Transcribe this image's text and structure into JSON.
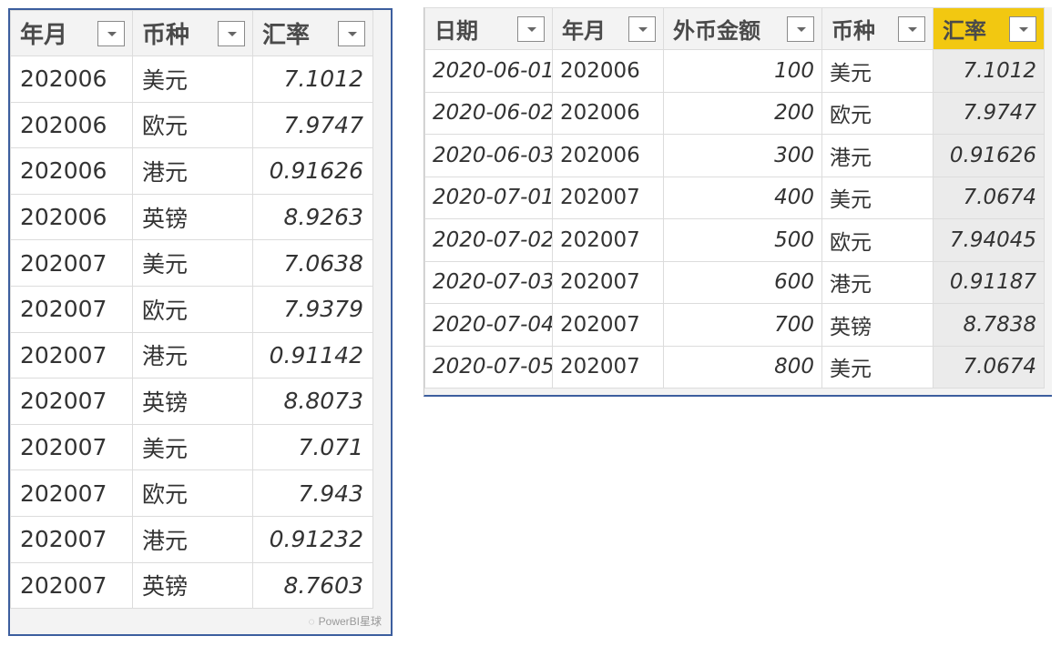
{
  "left_table": {
    "columns": [
      "年月",
      "币种",
      "汇率"
    ],
    "rows": [
      [
        "202006",
        "美元",
        "7.1012"
      ],
      [
        "202006",
        "欧元",
        "7.9747"
      ],
      [
        "202006",
        "港元",
        "0.91626"
      ],
      [
        "202006",
        "英镑",
        "8.9263"
      ],
      [
        "202007",
        "美元",
        "7.0638"
      ],
      [
        "202007",
        "欧元",
        "7.9379"
      ],
      [
        "202007",
        "港元",
        "0.91142"
      ],
      [
        "202007",
        "英镑",
        "8.8073"
      ],
      [
        "202007",
        "美元",
        "7.071"
      ],
      [
        "202007",
        "欧元",
        "7.943"
      ],
      [
        "202007",
        "港元",
        "0.91232"
      ],
      [
        "202007",
        "英镑",
        "8.7603"
      ]
    ]
  },
  "right_table": {
    "columns": [
      "日期",
      "年月",
      "外币金额",
      "币种",
      "汇率"
    ],
    "selected_column": "汇率",
    "rows": [
      [
        "2020-06-01",
        "202006",
        "100",
        "美元",
        "7.1012"
      ],
      [
        "2020-06-02",
        "202006",
        "200",
        "欧元",
        "7.9747"
      ],
      [
        "2020-06-03",
        "202006",
        "300",
        "港元",
        "0.91626"
      ],
      [
        "2020-07-01",
        "202007",
        "400",
        "美元",
        "7.0674"
      ],
      [
        "2020-07-02",
        "202007",
        "500",
        "欧元",
        "7.94045"
      ],
      [
        "2020-07-03",
        "202007",
        "600",
        "港元",
        "0.91187"
      ],
      [
        "2020-07-04",
        "202007",
        "700",
        "英镑",
        "8.7838"
      ],
      [
        "2020-07-05",
        "202007",
        "800",
        "美元",
        "7.0674"
      ]
    ]
  },
  "watermark": "PowerBI星球",
  "colors": {
    "selected_header": "#f2c811",
    "frame": "#3c5e9e"
  },
  "icons": {
    "dropdown": "chevron-down-icon",
    "watermark": "wechat-icon"
  }
}
